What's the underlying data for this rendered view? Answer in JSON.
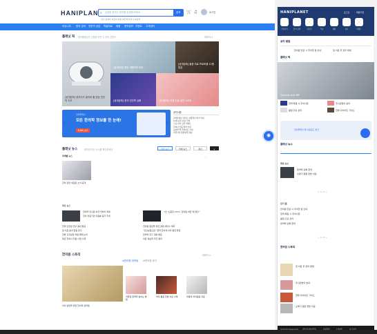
{
  "desktop": {
    "logo": "HANIPLANET",
    "search": {
      "placeholder": "궁금한 한의사 정보를 검색해 보세요",
      "button": "검색"
    },
    "hot_tags": "인기 검색어  #한의 #침 #한약 #추나 #보약",
    "login": "로그인",
    "nav": [
      "커뮤니티",
      "한의 강좌",
      "전문가 상담",
      "학술자료",
      "채용",
      "한의정보",
      "이벤트",
      "고객센터"
    ],
    "featured": {
      "title": "플래닛 픽",
      "subtitle": "한의플래닛이 선정한 이번 주 추천 콘텐츠",
      "more": "더보기 >"
    },
    "hero_caps": [
      "[공개강좌] 한의사가 알아야 할 영상 진단의 기초",
      "[공개강좌] 한방 재활의학 특강",
      "[공개강좌] 통증 치료 프로토콜 12월 특강",
      "[공개강좌] 한의 진단학 심화",
      "[공개강좌] 약침 치료 실전 노하우",
      "[공개강좌] 한의학과 웰니스"
    ],
    "banner": {
      "label": "한의플래닛",
      "title": "모든 한의학 정보를 한 눈에!",
      "button": "자세히 보기"
    },
    "side_list": {
      "header": "공지사항",
      "items": [
        "한의플래닛 서비스 이용약관 변경 안내",
        "12월 정기 점검 안내",
        "신규 강좌 오픈 이벤트",
        "한의사 인증 절차 안내",
        "모바일 앱 업데이트 안내",
        "커뮤니티 운영정책 개정"
      ]
    },
    "news": {
      "title": "플래닛 뉴스",
      "subtitle": "한의계 최신 소식을 확인하세요",
      "tabs": [
        "한의 뉴스",
        "전체 뉴스",
        "최신"
      ]
    },
    "topic": {
      "label": "주제별 뉴스",
      "caption": "한의 관련 새로운 소식 공개"
    },
    "latest": {
      "label": "주요 뉴스",
      "items": [
        "한의학 연구원 외국 학술지 게재",
        "한의 의료기관 이용률 증가 추세",
        "한약 안전성 연구 결과 발표",
        "침 치료 효과 입증 연구",
        "한방 건강보험 적용 확대 논의",
        "청년 한의사 지원 사업 시행",
        "한의 교육 과정 개편 추진"
      ]
    },
    "latest2": {
      "items": [
        "\"내 \"소중한 CCTV, 한의원 어떤 역할은?\"",
        "한의원 원장을 위한 경영 세미나 개최",
        "\"건강보험으로\" 협약 한의계 이후 발전 방향",
        "한의약 진흥 계획 발표",
        "의료 정보화 추진 결과"
      ]
    },
    "story": {
      "title": "한의원 스토리",
      "tabs": [
        "#한의원 마케팅",
        "#한의원 후기"
      ],
      "more": "더보기 >"
    },
    "story_items": [
      "아이 성장을 위한 한의학 관리법",
      "겨울철 면역력 높이는 방법",
      "허리 통증 한방 치료 사례",
      "두통과 어지럼증 치료",
      "피부 건강 관리 노하우"
    ]
  },
  "mobile": {
    "logo": "HANIPLANET",
    "top_links": [
      "로그인",
      "회원가입"
    ],
    "icons": [
      "커뮤니티",
      "한의 강좌",
      "전문가",
      "학술",
      "채용",
      "정보",
      "이벤트"
    ],
    "sections": {
      "notice": "공지 알림",
      "hot": "플래닛 픽",
      "news": "플래닛 뉴스",
      "community": "주요 뉴스",
      "forum": "인기 글",
      "story": "한의원 스토리"
    },
    "hero_caption": "Shoulder Joint MRI",
    "list_items": [
      "한의원 진료 시 주의할 점 안내",
      "침 치료 후 관리 방법",
      "한약 복용 시 주의사항",
      "추나요법의 효과",
      "봄철 건강 관리",
      "한방 다이어트 가이드",
      "면역력 강화 한약",
      "소화기 질환 한방 치료"
    ],
    "banner": "한의플래닛 앱 다운로드 받기",
    "footer": [
      "All Rights Reserved",
      "개인정보처리방침",
      "이용약관",
      "고객센터",
      "광고문의"
    ],
    "pager": "< 1 / 5 >"
  },
  "colors": {
    "accent": "#2b7ff0",
    "navy": "#1e3a6e"
  }
}
